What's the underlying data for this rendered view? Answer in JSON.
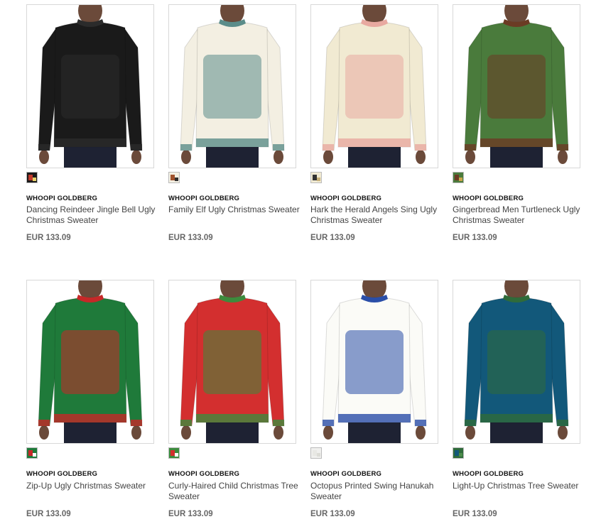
{
  "products": [
    {
      "brand": "WHOOPI GOLDBERG",
      "name": "Dancing Reindeer Jingle Bell Ugly Christmas Sweater",
      "price": "EUR 133.09",
      "sweater_color": "#1a1a1a",
      "accent_color": "#2b2b2b",
      "swatch_colors": [
        "#1a1a1a",
        "#c0392b",
        "#e8d46a"
      ]
    },
    {
      "brand": "WHOOPI GOLDBERG",
      "name": "Family Elf Ugly Christmas Sweater",
      "price": "EUR 133.09",
      "sweater_color": "#f3efe2",
      "accent_color": "#5b8d8a",
      "swatch_colors": [
        "#f3efe2",
        "#a0522d",
        "#2e2e2e"
      ]
    },
    {
      "brand": "WHOOPI GOLDBERG",
      "name": "Hark the Herald Angels Sing Ugly Christmas Sweater",
      "price": "EUR 133.09",
      "sweater_color": "#f1ead2",
      "accent_color": "#e8a9a0",
      "swatch_colors": [
        "#f1ead2",
        "#333333",
        "#c9b27a"
      ]
    },
    {
      "brand": "WHOOPI GOLDBERG",
      "name": "Gingerbread Men Turtleneck Ugly Christmas Sweater",
      "price": "EUR 133.09",
      "sweater_color": "#4a7b3c",
      "accent_color": "#6b3b24",
      "swatch_colors": [
        "#4a7b3c",
        "#6b3b24",
        "#c9a54a"
      ]
    },
    {
      "brand": "WHOOPI GOLDBERG",
      "name": "Zip-Up Ugly Christmas Sweater",
      "price": "EUR 133.09",
      "sweater_color": "#1f7a3a",
      "accent_color": "#c62828",
      "swatch_colors": [
        "#1f7a3a",
        "#c62828",
        "#ffffff"
      ]
    },
    {
      "brand": "WHOOPI GOLDBERG",
      "name": "Curly-Haired Child Christmas Tree Sweater",
      "price": "EUR 133.09",
      "sweater_color": "#d32f2f",
      "accent_color": "#3d8b3d",
      "swatch_colors": [
        "#3d8b3d",
        "#d32f2f",
        "#ffffff"
      ]
    },
    {
      "brand": "WHOOPI GOLDBERG",
      "name": "Octopus Printed Swing Hanukah Sweater",
      "price": "EUR 133.09",
      "sweater_color": "#fbfbf7",
      "accent_color": "#2a4ea8",
      "swatch_colors": [
        "#f0f0ee",
        "#e8e8e4",
        "#dcdcd6"
      ]
    },
    {
      "brand": "WHOOPI GOLDBERG",
      "name": "Light-Up Christmas Tree Sweater",
      "price": "EUR 133.09",
      "sweater_color": "#12587a",
      "accent_color": "#2f6b3a",
      "swatch_colors": [
        "#2f6b3a",
        "#12587a",
        "#4c8c4a"
      ]
    }
  ]
}
